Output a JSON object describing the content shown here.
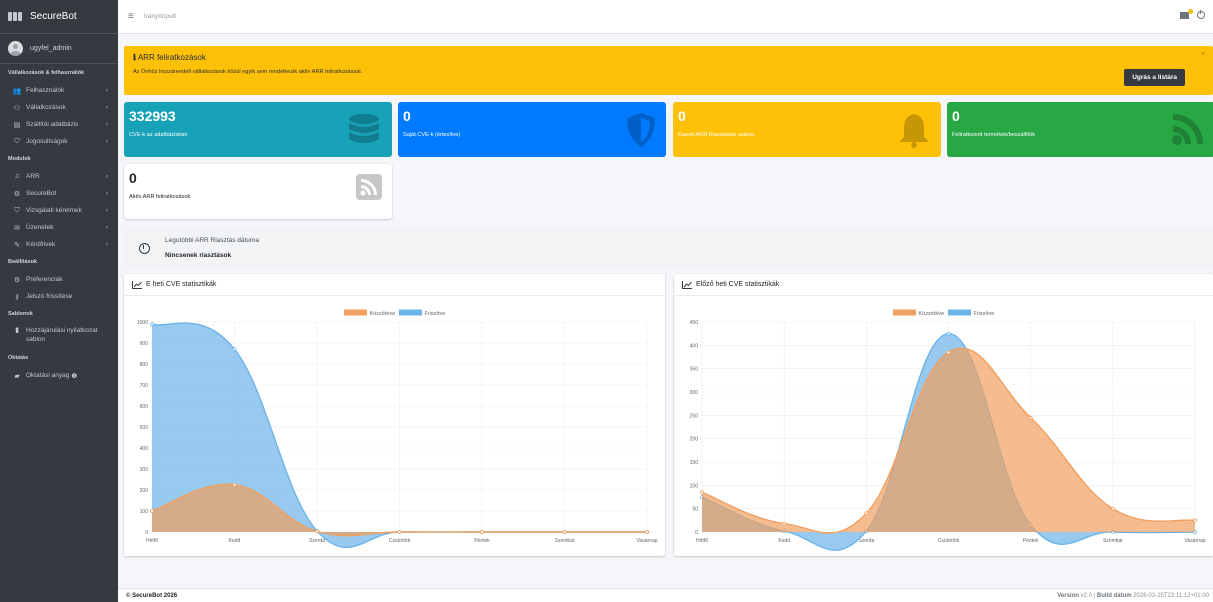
{
  "app": {
    "brand": "SecureBot",
    "user": "ugyfel_admin",
    "page_title": "Irányítópult"
  },
  "sidebar": {
    "sections": [
      {
        "header": "Vállalkozások & felhasználók",
        "items": [
          {
            "label": "Felhasználók",
            "icon": "users-icon",
            "chevron": "‹"
          },
          {
            "label": "Vállalkozások",
            "icon": "handshake-icon",
            "chevron": "‹"
          },
          {
            "label": "Szállítói adatbázis",
            "icon": "database-icon",
            "chevron": "‹"
          },
          {
            "label": "Jogosultságok",
            "icon": "shield-icon",
            "chevron": "‹"
          }
        ]
      },
      {
        "header": "Modulok",
        "items": [
          {
            "label": "ARR",
            "icon": "bell-icon",
            "chevron": "‹"
          },
          {
            "label": "SecureBot",
            "icon": "robot-icon",
            "chevron": "‹"
          },
          {
            "label": "Vizsgálati kérelmek",
            "icon": "shield-icon",
            "chevron": "‹"
          },
          {
            "label": "Üzenetek",
            "icon": "envelope-icon",
            "chevron": "‹"
          },
          {
            "label": "Kérdőívek",
            "icon": "pencil-icon",
            "chevron": "‹"
          }
        ]
      },
      {
        "header": "Beállítások",
        "items": [
          {
            "label": "Preferenciák",
            "icon": "gears-icon",
            "chevron": ""
          },
          {
            "label": "Jelszó frissítése",
            "icon": "key-icon",
            "chevron": ""
          }
        ]
      },
      {
        "header": "Sablonok",
        "items": [
          {
            "label": "Hozzájárulási nyilatkozat sablon",
            "icon": "file-icon",
            "chevron": ""
          }
        ]
      },
      {
        "header": "Oktatás",
        "items": [
          {
            "label": "Oktatási anyag",
            "icon": "book-icon",
            "chevron": ""
          }
        ]
      }
    ]
  },
  "alert": {
    "title": "ARR feliratkozások",
    "text": "Az Önhöz hozzárendelt vállalkozások közül egyik sem rendelkezik aktív ARR feliratkozással.",
    "button": "Ugrás a listára",
    "close": "×"
  },
  "info_boxes": [
    {
      "value": "332993",
      "label": "CVE-k az adatbázisban",
      "color": "#17a2b8",
      "icon": "database-icon"
    },
    {
      "value": "0",
      "label": "Saját CVE-k (értesítve)",
      "color": "#007bff",
      "icon": "shield-icon"
    },
    {
      "value": "0",
      "label": "Kapott ARR Riasztások száma",
      "color": "#ffc107",
      "icon": "bell-icon"
    },
    {
      "value": "0",
      "label": "Feliratkozott termékek/beszállítók",
      "color": "#28a745",
      "icon": "rss-icon"
    },
    {
      "value": "0",
      "label": "Aktív ARR feliratkozások",
      "color": "#ffffff",
      "icon": "rss-icon"
    }
  ],
  "last_alert": {
    "title": "Legutóbbi ARR Riasztás dátuma",
    "value": "Nincsenek riasztások"
  },
  "chart_data": [
    {
      "type": "area",
      "title": "E heti CVE statisztikák",
      "categories": [
        "Hétfő",
        "Kedd",
        "Szerda",
        "Csütörtök",
        "Péntek",
        "Szombat",
        "Vasárnap"
      ],
      "ylim": [
        0,
        1000
      ],
      "yticks": [
        0,
        100,
        200,
        300,
        400,
        500,
        600,
        700,
        800,
        900,
        1000
      ],
      "series": [
        {
          "name": "Közzétéve",
          "color": "#f0a060",
          "values": [
            100,
            225,
            3,
            0,
            0,
            0,
            0
          ]
        },
        {
          "name": "Frissítve",
          "color": "#6cb4e8",
          "values": [
            990,
            870,
            5,
            0,
            0,
            0,
            0
          ]
        }
      ],
      "legend": "top"
    },
    {
      "type": "area",
      "title": "Előző heti CVE statisztikák",
      "categories": [
        "Hétfő",
        "Kedd",
        "Szerda",
        "Csütörtök",
        "Péntek",
        "Szombat",
        "Vasárnap"
      ],
      "ylim": [
        0,
        450
      ],
      "yticks": [
        0,
        50,
        100,
        150,
        200,
        250,
        300,
        350,
        400,
        450
      ],
      "series": [
        {
          "name": "Közzétéve",
          "color": "#f0a060",
          "values": [
            85,
            18,
            40,
            385,
            245,
            50,
            25
          ]
        },
        {
          "name": "Frissítve",
          "color": "#6cb4e8",
          "values": [
            75,
            2,
            2,
            425,
            15,
            0,
            0
          ]
        }
      ],
      "legend": "top"
    }
  ],
  "footer": {
    "copyright": "© SecureBot 2026",
    "version_label": "Version",
    "version": "v2.0",
    "build_label": "Build dátum",
    "build": "2026-02-25T23:11:12+01:00",
    "separator": "|"
  }
}
